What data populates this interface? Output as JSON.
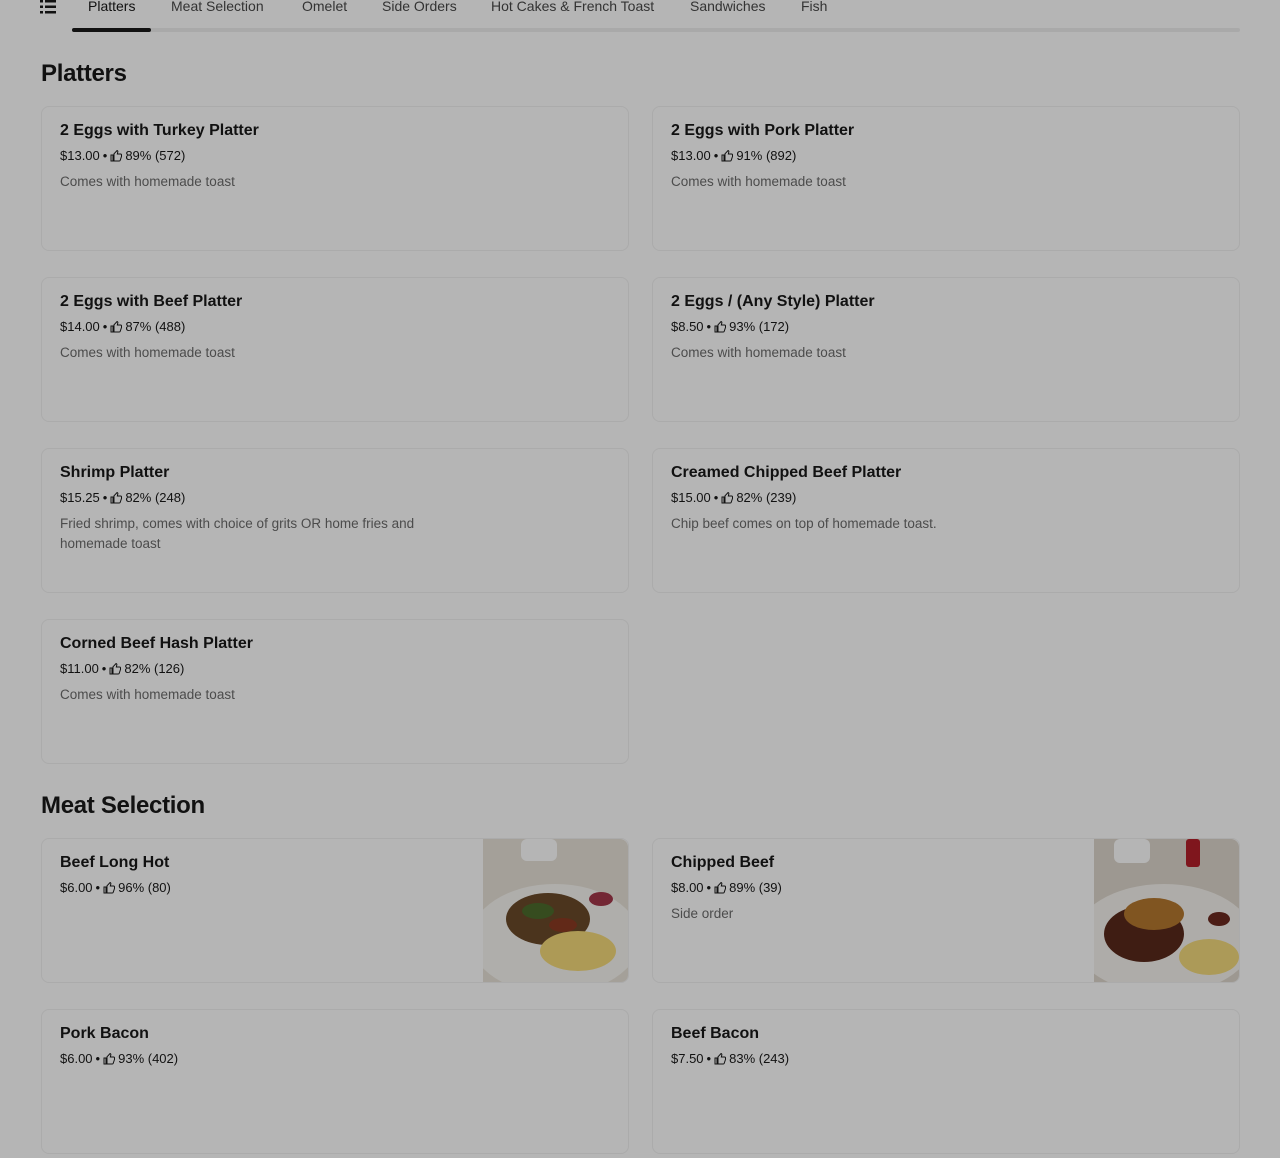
{
  "nav": {
    "tabs": [
      {
        "label": "Platters"
      },
      {
        "label": "Meat Selection"
      },
      {
        "label": "Omelet"
      },
      {
        "label": "Side Orders"
      },
      {
        "label": "Hot Cakes & French Toast"
      },
      {
        "label": "Sandwiches"
      },
      {
        "label": "Fish"
      }
    ],
    "active": "Platters"
  },
  "sections": {
    "platters": {
      "title": "Platters",
      "items": [
        {
          "name": "2 Eggs with Turkey Platter",
          "price": "$13.00",
          "rating": "89% (572)",
          "description": "Comes with homemade toast"
        },
        {
          "name": "2 Eggs with Pork Platter",
          "price": "$13.00",
          "rating": "91% (892)",
          "description": "Comes with homemade toast"
        },
        {
          "name": "2 Eggs with Beef Platter",
          "price": "$14.00",
          "rating": "87% (488)",
          "description": "Comes with homemade toast"
        },
        {
          "name": "2 Eggs / (Any Style) Platter",
          "price": "$8.50",
          "rating": "93% (172)",
          "description": "Comes with homemade toast"
        },
        {
          "name": "Shrimp Platter",
          "price": "$15.25",
          "rating": "82% (248)",
          "description": "Fried shrimp, comes with choice of grits OR home fries and homemade toast"
        },
        {
          "name": "Creamed Chipped Beef Platter",
          "price": "$15.00",
          "rating": "82% (239)",
          "description": "Chip beef comes on top of homemade toast."
        },
        {
          "name": "Corned Beef Hash Platter",
          "price": "$11.00",
          "rating": "82% (126)",
          "description": "Comes with homemade toast"
        }
      ]
    },
    "meat": {
      "title": "Meat Selection",
      "items": [
        {
          "name": "Beef Long Hot",
          "price": "$6.00",
          "rating": "96% (80)",
          "description": ""
        },
        {
          "name": "Chipped Beef",
          "price": "$8.00",
          "rating": "89% (39)",
          "description": "Side order"
        },
        {
          "name": "Pork Bacon",
          "price": "$6.00",
          "rating": "93% (402)",
          "description": ""
        },
        {
          "name": "Beef Bacon",
          "price": "$7.50",
          "rating": "83% (243)",
          "description": ""
        }
      ]
    }
  },
  "separator": "•",
  "icons": {
    "menu": "list-icon",
    "rating": "thumbs-up-icon"
  }
}
